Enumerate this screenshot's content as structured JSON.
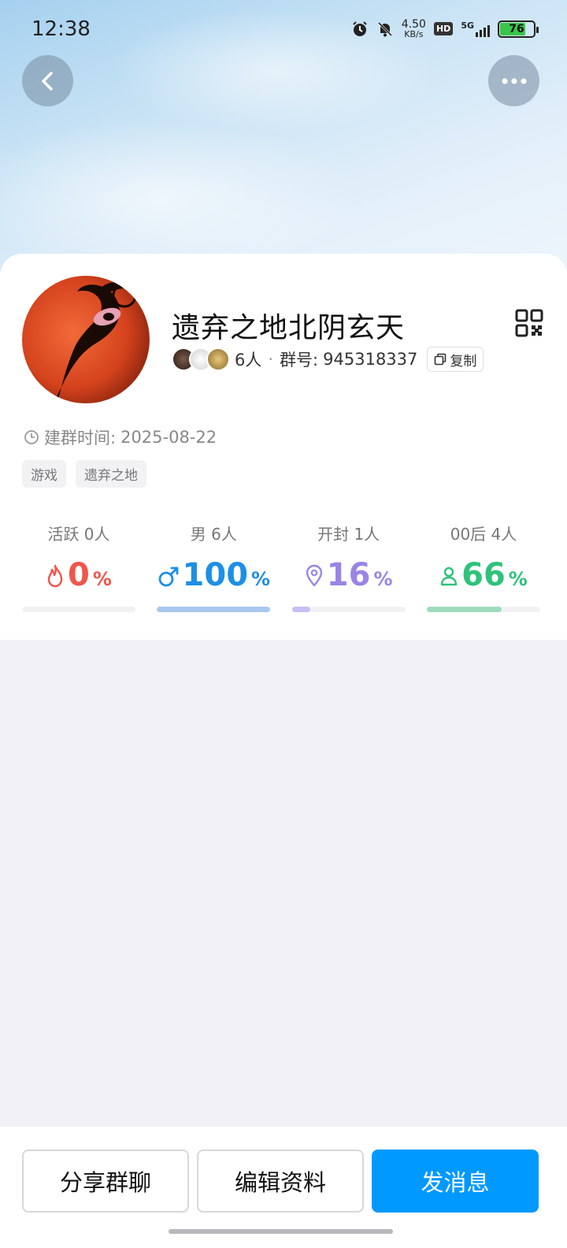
{
  "status_bar": {
    "time": "12:38",
    "net_speed_value": "4.50",
    "net_speed_unit": "KB/s",
    "hd_label": "HD",
    "network_label": "5G",
    "battery_level": "76"
  },
  "header": {
    "back_icon": "chevron-left-icon",
    "more_icon": "more-horizontal-icon"
  },
  "group": {
    "name": "遗弃之地北阴玄天",
    "member_count_text": "6人",
    "separator": "·",
    "group_id_label": "群号:",
    "group_id": "945318337",
    "copy_label": "复制",
    "created_label": "建群时间:",
    "created_date": "2025-08-22",
    "tags": [
      "游戏",
      "遗弃之地"
    ]
  },
  "stats": [
    {
      "label": "活跃 0人",
      "value": "0",
      "unit": "%",
      "color": "#f0564a",
      "fill": 0,
      "bar_color": "#f0564a",
      "icon": "flame-icon"
    },
    {
      "label": "男 6人",
      "value": "100",
      "unit": "%",
      "color": "#1d8fe6",
      "fill": 100,
      "bar_color": "#a9c8f0",
      "icon": "male-icon"
    },
    {
      "label": "开封 1人",
      "value": "16",
      "unit": "%",
      "color": "#9a84e6",
      "fill": 16,
      "bar_color": "#c9bdf3",
      "icon": "location-pin-icon"
    },
    {
      "label": "00后 4人",
      "value": "66",
      "unit": "%",
      "color": "#2fc27b",
      "fill": 66,
      "bar_color": "#9edcbd",
      "icon": "person-icon"
    }
  ],
  "actions": {
    "share_label": "分享群聊",
    "edit_label": "编辑资料",
    "message_label": "发消息"
  },
  "colors": {
    "primary": "#0099ff",
    "card_bg": "#ffffff",
    "page_bg": "#f1f1f6"
  }
}
